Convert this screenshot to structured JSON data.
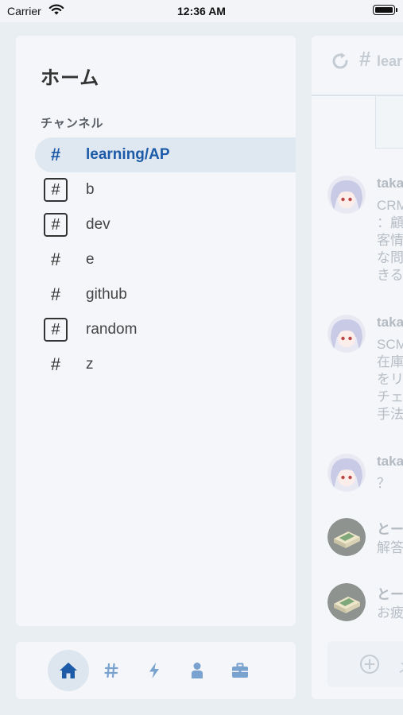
{
  "status_bar": {
    "carrier": "Carrier",
    "time": "12:36 AM"
  },
  "sidebar": {
    "title": "ホーム",
    "section_label": "チャンネル",
    "channels": [
      {
        "label": "learning/AP",
        "icon": "hash-icon",
        "active": true
      },
      {
        "label": "b",
        "icon": "hash-box-icon"
      },
      {
        "label": "dev",
        "icon": "hash-box-icon"
      },
      {
        "label": "e",
        "icon": "hash-icon"
      },
      {
        "label": "github",
        "icon": "hash-icon"
      },
      {
        "label": "random",
        "icon": "hash-box-icon"
      },
      {
        "label": "z",
        "icon": "hash-icon"
      }
    ]
  },
  "tabbar": {
    "items": [
      {
        "icon": "home-icon",
        "active": true
      },
      {
        "icon": "hash-icon"
      },
      {
        "icon": "lightning-icon"
      },
      {
        "icon": "person-icon"
      },
      {
        "icon": "briefcase-icon"
      }
    ]
  },
  "main": {
    "header": {
      "hash": "#",
      "title": "lear"
    },
    "messages": [
      {
        "author": "taka",
        "avatar": "anime-avatar",
        "lines": [
          "CRM",
          "：顧",
          "客情",
          "な問",
          "きる"
        ]
      },
      {
        "author": "taka",
        "avatar": "anime-avatar",
        "lines": [
          "SCM",
          "在庫",
          "をリ",
          "チェ",
          "手法"
        ]
      },
      {
        "author": "taka",
        "avatar": "anime-avatar",
        "lines": [
          "？"
        ]
      },
      {
        "author": "とー",
        "avatar": "box-avatar",
        "lines": [
          "解答"
        ]
      },
      {
        "author": "とー",
        "avatar": "box-avatar",
        "lines": [
          "お疲"
        ]
      }
    ],
    "composer": {
      "plus_icon": "plus-circle-icon",
      "trailing": "メ"
    }
  },
  "colors": {
    "accent": "#1d5ba8",
    "tab_icon": "#7aa2cf",
    "active_tab_icon": "#1d5ba8"
  }
}
